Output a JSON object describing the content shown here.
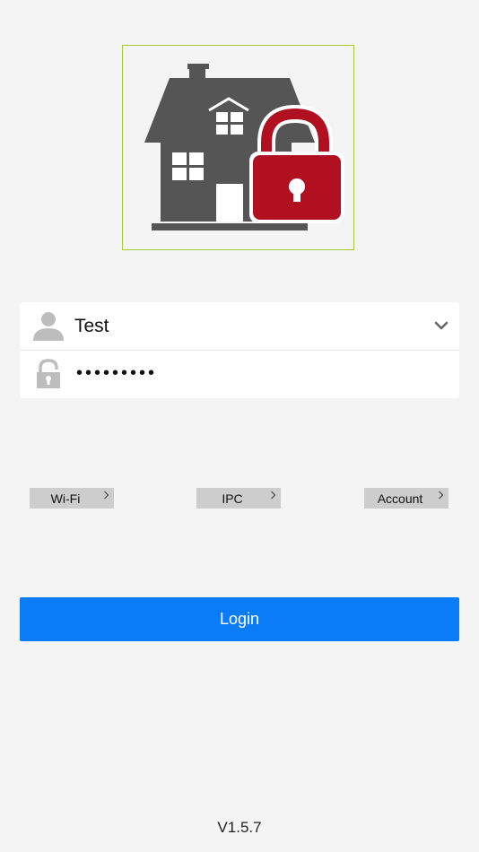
{
  "logo": {
    "icon": "house-with-padlock-icon",
    "colors": {
      "border": "#a8c83a",
      "house": "#555555",
      "lock": "#b0101f"
    }
  },
  "form": {
    "username": "Test",
    "password_masked": "•••••••••",
    "user_icon": "user-silhouette-icon",
    "lock_icon": "padlock-icon",
    "dropdown_icon": "chevron-down-icon"
  },
  "links": [
    {
      "label": "Wi-Fi"
    },
    {
      "label": "IPC"
    },
    {
      "label": "Account"
    }
  ],
  "login": {
    "label": "Login",
    "color": "#0a7cf7"
  },
  "footer": {
    "version": "V1.5.7"
  }
}
